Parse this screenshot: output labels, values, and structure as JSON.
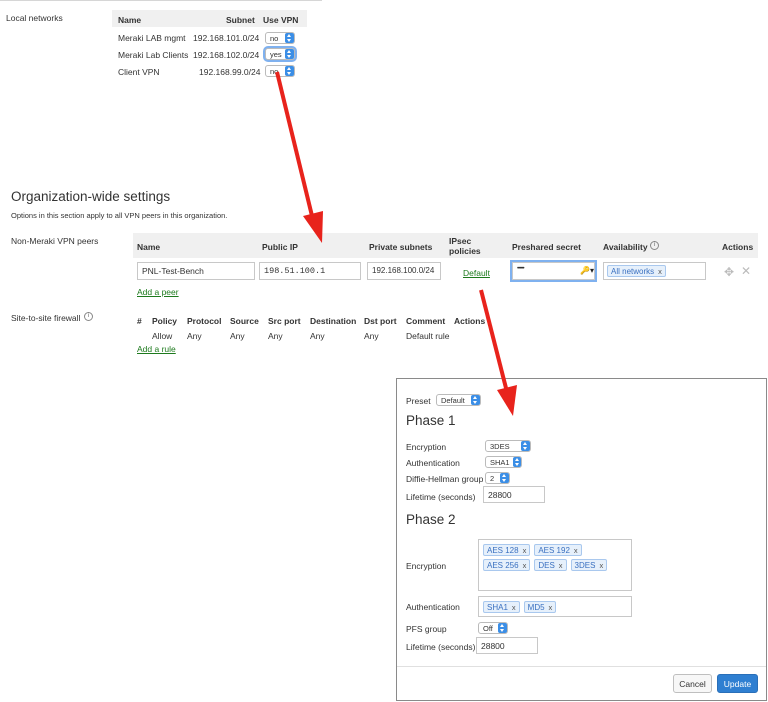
{
  "local_networks": {
    "label": "Local networks",
    "headers": {
      "name": "Name",
      "subnet": "Subnet",
      "use_vpn": "Use VPN"
    },
    "rows": [
      {
        "name": "Meraki LAB mgmt",
        "subnet": "192.168.101.0/24",
        "use_vpn": "no"
      },
      {
        "name": "Meraki Lab Clients",
        "subnet": "192.168.102.0/24",
        "use_vpn": "yes"
      },
      {
        "name": "Client VPN",
        "subnet": "192.168.99.0/24",
        "use_vpn": "no"
      }
    ]
  },
  "org": {
    "title": "Organization-wide settings",
    "subtitle": "Options in this section apply to all VPN peers in this organization."
  },
  "peers": {
    "label": "Non-Meraki VPN peers",
    "headers": {
      "name": "Name",
      "public_ip": "Public IP",
      "private_subnets": "Private subnets",
      "ipsec_line1": "IPsec",
      "ipsec_line2": "policies",
      "secret": "Preshared secret",
      "availability": "Availability",
      "actions": "Actions"
    },
    "row": {
      "name": "PNL-Test-Bench",
      "public_ip": "198.51.100.1",
      "private_subnets": "192.168.100.0/24",
      "ipsec": "Default",
      "secret": "••••••",
      "availability_tag": "All networks",
      "tag_remove": "x"
    },
    "add_link": "Add a peer"
  },
  "firewall": {
    "label": "Site-to-site firewall",
    "headers": {
      "num": "#",
      "policy": "Policy",
      "protocol": "Protocol",
      "source": "Source",
      "src_port": "Src port",
      "destination": "Destination",
      "dst_port": "Dst port",
      "comment": "Comment",
      "actions": "Actions"
    },
    "row": {
      "policy": "Allow",
      "protocol": "Any",
      "source": "Any",
      "src_port": "Any",
      "destination": "Any",
      "dst_port": "Any",
      "comment": "Default rule"
    },
    "add_link": "Add a rule"
  },
  "modal": {
    "preset_label": "Preset",
    "preset_value": "Default",
    "phase1_title": "Phase 1",
    "p1_encryption_label": "Encryption",
    "p1_encryption_value": "3DES",
    "p1_auth_label": "Authentication",
    "p1_auth_value": "SHA1",
    "p1_dh_label": "Diffie-Hellman group",
    "p1_dh_value": "2",
    "p1_lifetime_label": "Lifetime (seconds)",
    "p1_lifetime_value": "28800",
    "phase2_title": "Phase 2",
    "p2_encryption_label": "Encryption",
    "p2_encryption_tags": [
      "AES 128",
      "AES 192",
      "AES 256",
      "DES",
      "3DES"
    ],
    "p2_auth_label": "Authentication",
    "p2_auth_tags": [
      "SHA1",
      "MD5"
    ],
    "p2_pfs_label": "PFS group",
    "p2_pfs_value": "Off",
    "p2_lifetime_label": "Lifetime (seconds)",
    "p2_lifetime_value": "28800",
    "tag_remove": "x",
    "cancel_label": "Cancel",
    "update_label": "Update"
  },
  "colors": {
    "arrow": "#e8231c",
    "link": "#1d7a1d",
    "primary_button": "#2f7fd1",
    "tag_fill": "#e6f0fb"
  }
}
